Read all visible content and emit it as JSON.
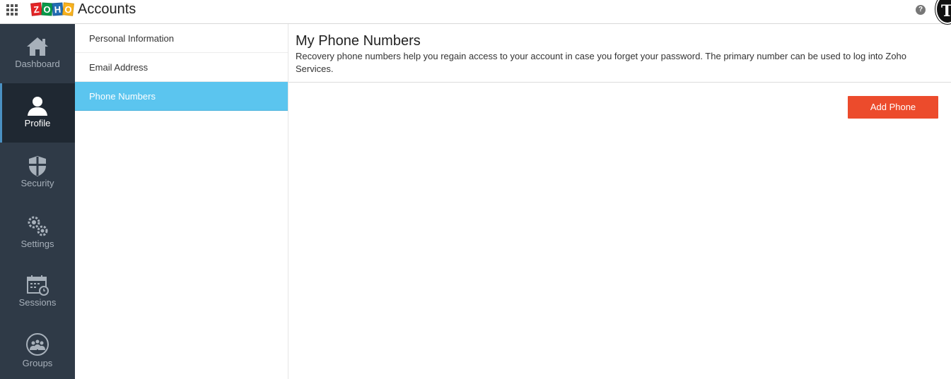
{
  "header": {
    "logo_letters": [
      "Z",
      "O",
      "H",
      "O"
    ],
    "app_title": "Accounts",
    "help_symbol": "?",
    "avatar_initial": "T",
    "icons": {
      "apps": "app-grid-icon",
      "help": "help-icon"
    }
  },
  "sidebar": {
    "items": [
      {
        "label": "Dashboard",
        "icon": "home-icon",
        "active": false
      },
      {
        "label": "Profile",
        "icon": "user-icon",
        "active": true
      },
      {
        "label": "Security",
        "icon": "shield-icon",
        "active": false
      },
      {
        "label": "Settings",
        "icon": "gears-icon",
        "active": false
      },
      {
        "label": "Sessions",
        "icon": "calendar-clock-icon",
        "active": false
      },
      {
        "label": "Groups",
        "icon": "group-icon",
        "active": false
      }
    ]
  },
  "submenu": {
    "items": [
      {
        "label": "Personal Information",
        "active": false
      },
      {
        "label": "Email Address",
        "active": false
      },
      {
        "label": "Phone Numbers",
        "active": true
      }
    ]
  },
  "main": {
    "title": "My Phone Numbers",
    "description": "Recovery phone numbers help you regain access to your account in case you forget your password. The primary number can be used to log into Zoho Services.",
    "add_button_label": "Add Phone"
  },
  "colors": {
    "nav_bg": "#2f3a47",
    "nav_active_bg": "#1f2832",
    "submenu_active": "#5bc5ef",
    "primary_button": "#ec4b2c"
  }
}
